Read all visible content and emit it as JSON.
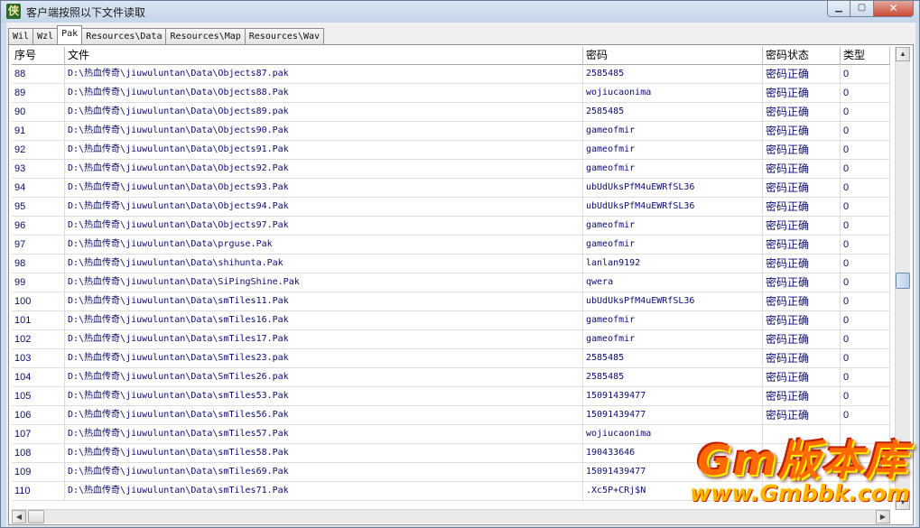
{
  "window": {
    "title": "客户端按照以下文件读取",
    "icon": "game-app-icon",
    "icon_glyph": "侠"
  },
  "controls": {
    "minimize": "▁",
    "maximize": "▢",
    "close": "✕"
  },
  "tabs": [
    {
      "label": "Wil",
      "active": false
    },
    {
      "label": "Wzl",
      "active": false
    },
    {
      "label": "Pak",
      "active": true
    },
    {
      "label": "Resources\\Data",
      "active": false
    },
    {
      "label": "Resources\\Map",
      "active": false
    },
    {
      "label": "Resources\\Wav",
      "active": false
    }
  ],
  "grid": {
    "columns": [
      "序号",
      "文件",
      "密码",
      "密码状态",
      "类型"
    ],
    "rows": [
      {
        "id": "88",
        "file": "D:\\热血传奇\\jiuwuluntan\\Data\\Objects87.pak",
        "password": "2585485",
        "status": "密码正确",
        "type": "0"
      },
      {
        "id": "89",
        "file": "D:\\热血传奇\\jiuwuluntan\\Data\\Objects88.Pak",
        "password": "wojiucaonima",
        "status": "密码正确",
        "type": "0"
      },
      {
        "id": "90",
        "file": "D:\\热血传奇\\jiuwuluntan\\Data\\Objects89.pak",
        "password": "2585485",
        "status": "密码正确",
        "type": "0"
      },
      {
        "id": "91",
        "file": "D:\\热血传奇\\jiuwuluntan\\Data\\Objects90.Pak",
        "password": "gameofmir",
        "status": "密码正确",
        "type": "0"
      },
      {
        "id": "92",
        "file": "D:\\热血传奇\\jiuwuluntan\\Data\\Objects91.Pak",
        "password": "gameofmir",
        "status": "密码正确",
        "type": "0"
      },
      {
        "id": "93",
        "file": "D:\\热血传奇\\jiuwuluntan\\Data\\Objects92.Pak",
        "password": "gameofmir",
        "status": "密码正确",
        "type": "0"
      },
      {
        "id": "94",
        "file": "D:\\热血传奇\\jiuwuluntan\\Data\\Objects93.Pak",
        "password": "ubUdUksPfM4uEWRfSL36",
        "status": "密码正确",
        "type": "0"
      },
      {
        "id": "95",
        "file": "D:\\热血传奇\\jiuwuluntan\\Data\\Objects94.Pak",
        "password": "ubUdUksPfM4uEWRfSL36",
        "status": "密码正确",
        "type": "0"
      },
      {
        "id": "96",
        "file": "D:\\热血传奇\\jiuwuluntan\\Data\\Objects97.Pak",
        "password": "gameofmir",
        "status": "密码正确",
        "type": "0"
      },
      {
        "id": "97",
        "file": "D:\\热血传奇\\jiuwuluntan\\Data\\prguse.Pak",
        "password": "gameofmir",
        "status": "密码正确",
        "type": "0"
      },
      {
        "id": "98",
        "file": "D:\\热血传奇\\jiuwuluntan\\Data\\shihunta.Pak",
        "password": "lanlan9192",
        "status": "密码正确",
        "type": "0"
      },
      {
        "id": "99",
        "file": "D:\\热血传奇\\jiuwuluntan\\Data\\SiPingShine.Pak",
        "password": "qwera",
        "status": "密码正确",
        "type": "0"
      },
      {
        "id": "100",
        "file": "D:\\热血传奇\\jiuwuluntan\\Data\\smTiles11.Pak",
        "password": "ubUdUksPfM4uEWRfSL36",
        "status": "密码正确",
        "type": "0"
      },
      {
        "id": "101",
        "file": "D:\\热血传奇\\jiuwuluntan\\Data\\smTiles16.Pak",
        "password": "gameofmir",
        "status": "密码正确",
        "type": "0"
      },
      {
        "id": "102",
        "file": "D:\\热血传奇\\jiuwuluntan\\Data\\smTiles17.Pak",
        "password": "gameofmir",
        "status": "密码正确",
        "type": "0"
      },
      {
        "id": "103",
        "file": "D:\\热血传奇\\jiuwuluntan\\Data\\SmTiles23.pak",
        "password": "2585485",
        "status": "密码正确",
        "type": "0"
      },
      {
        "id": "104",
        "file": "D:\\热血传奇\\jiuwuluntan\\Data\\SmTiles26.pak",
        "password": "2585485",
        "status": "密码正确",
        "type": "0"
      },
      {
        "id": "105",
        "file": "D:\\热血传奇\\jiuwuluntan\\Data\\smTiles53.Pak",
        "password": "15091439477",
        "status": "密码正确",
        "type": "0"
      },
      {
        "id": "106",
        "file": "D:\\热血传奇\\jiuwuluntan\\Data\\smTiles56.Pak",
        "password": "15091439477",
        "status": "密码正确",
        "type": "0"
      },
      {
        "id": "107",
        "file": "D:\\热血传奇\\jiuwuluntan\\Data\\smTiles57.Pak",
        "password": "wojiucaonima",
        "status": "",
        "type": ""
      },
      {
        "id": "108",
        "file": "D:\\热血传奇\\jiuwuluntan\\Data\\smTiles58.Pak",
        "password": "190433646",
        "status": "",
        "type": ""
      },
      {
        "id": "109",
        "file": "D:\\热血传奇\\jiuwuluntan\\Data\\smTiles69.Pak",
        "password": "15091439477",
        "status": "",
        "type": ""
      },
      {
        "id": "110",
        "file": "D:\\热血传奇\\jiuwuluntan\\Data\\smTiles71.Pak",
        "password": ".Xc5P+CRj$N",
        "status": "",
        "type": ""
      }
    ]
  },
  "watermark": {
    "title": "Gm版本库",
    "url": "www.Gmbbk.com"
  },
  "colors": {
    "title_bar": "#c3d5e9",
    "cell_text": "#0b0b6e",
    "watermark": "#ff6a00"
  }
}
